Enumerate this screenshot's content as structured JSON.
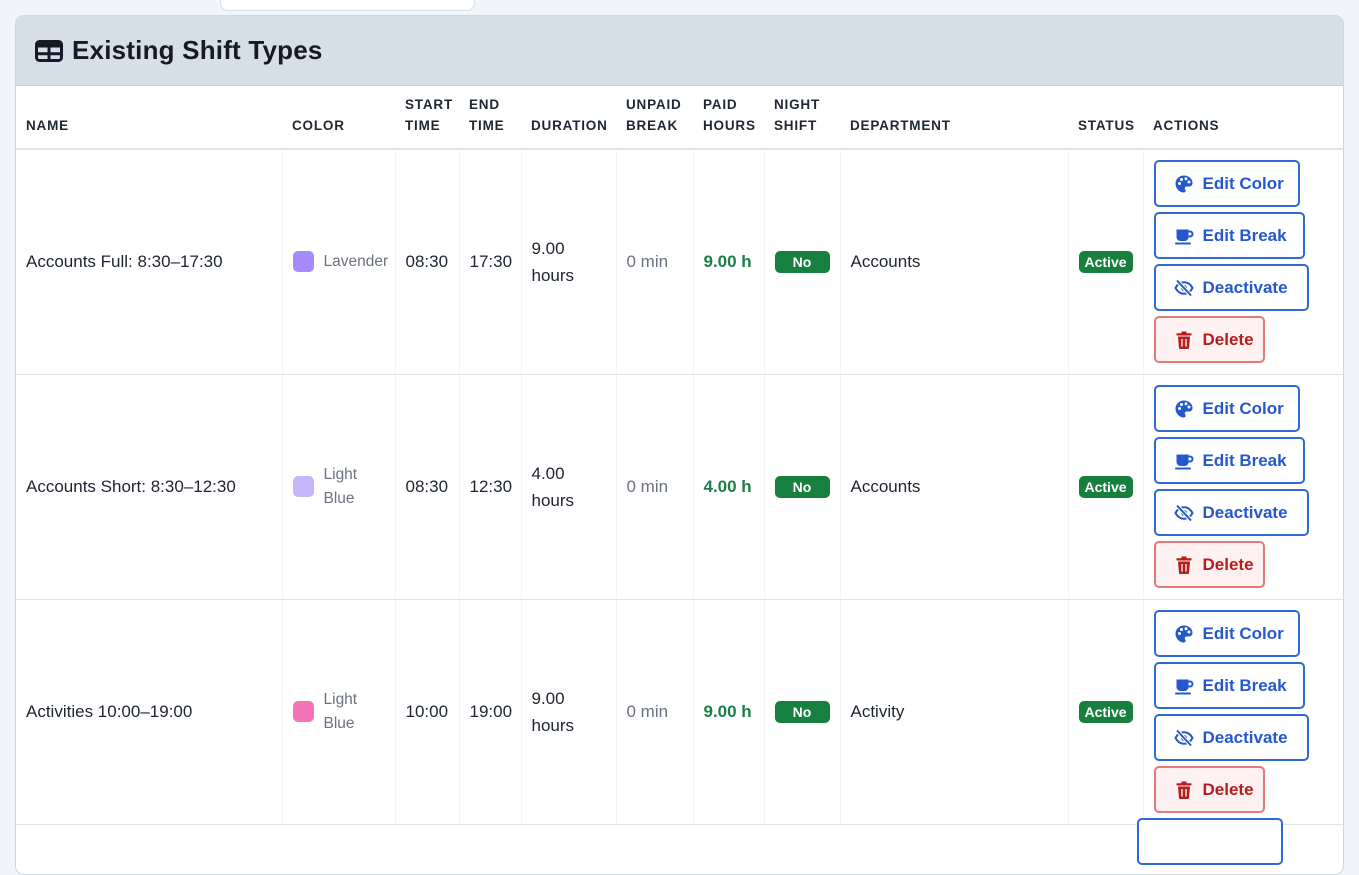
{
  "card": {
    "title": "Existing Shift Types",
    "title_icon": "table-icon"
  },
  "columns": {
    "name": "NAME",
    "color": "COLOR",
    "start": [
      "START",
      "TIME"
    ],
    "end": [
      "END",
      "TIME"
    ],
    "duration": "DURATION",
    "unpaid": [
      "UNPAID",
      "BREAK"
    ],
    "paid": [
      "PAID",
      "HOURS"
    ],
    "night": [
      "NIGHT",
      "SHIFT"
    ],
    "department": "DEPARTMENT",
    "status": "STATUS",
    "actions": "ACTIONS"
  },
  "actions": {
    "edit_color": "Edit Color",
    "edit_break": "Edit Break",
    "deactivate": "Deactivate",
    "delete": "Delete"
  },
  "rows": [
    {
      "name": "Accounts Full: 8:30–17:30",
      "color_hex": "#a78bfa",
      "color_name": [
        "Lavender"
      ],
      "start": "08:30",
      "end": "17:30",
      "duration": [
        "9.00",
        "hours"
      ],
      "unpaid_break": "0 min",
      "paid_hours": "9.00 h",
      "night_shift": "No",
      "department": "Accounts",
      "status": "Active"
    },
    {
      "name": "Accounts Short: 8:30–12:30",
      "color_hex": "#c4b5fd",
      "color_name": [
        "Light",
        "Blue"
      ],
      "start": "08:30",
      "end": "12:30",
      "duration": [
        "4.00",
        "hours"
      ],
      "unpaid_break": "0 min",
      "paid_hours": "4.00 h",
      "night_shift": "No",
      "department": "Accounts",
      "status": "Active"
    },
    {
      "name": "Activities 10:00–19:00",
      "color_hex": "#f472b6",
      "color_name": [
        "Light",
        "Blue"
      ],
      "start": "10:00",
      "end": "19:00",
      "duration": [
        "9.00",
        "hours"
      ],
      "unpaid_break": "0 min",
      "paid_hours": "9.00 h",
      "night_shift": "No",
      "department": "Activity",
      "status": "Active"
    }
  ],
  "colors": {
    "accent": "#2f68d8",
    "success": "#18803f",
    "danger": "#b61d1d",
    "header_bg": "#d6dee8"
  }
}
